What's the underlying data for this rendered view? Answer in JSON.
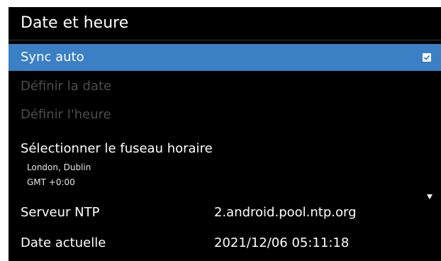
{
  "header": {
    "title": "Date et heure"
  },
  "menu": {
    "sync_auto": {
      "label": "Sync auto",
      "checked": true
    },
    "set_date": {
      "label": "Définir la date"
    },
    "set_time": {
      "label": "Définir l'heure"
    },
    "timezone": {
      "label": "Sélectionner le fuseau horaire",
      "city": "London, Dublin",
      "offset": "GMT +0:00"
    },
    "ntp_server": {
      "label": "Serveur NTP",
      "value": "2.android.pool.ntp.org"
    },
    "current_date": {
      "label": "Date actuelle",
      "value": "2021/12/06 05:11:18"
    }
  },
  "colors": {
    "selected": "#3b7fc4",
    "background": "#000000",
    "disabled_text": "#4d4d4d"
  },
  "icons": {
    "checkbox": "checkbox-checked-icon",
    "scroll": "scroll-down-arrow-icon"
  }
}
